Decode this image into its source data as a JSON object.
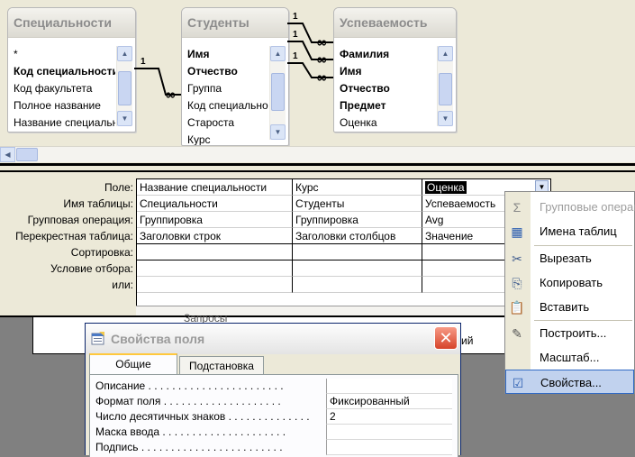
{
  "tables": [
    {
      "title": "Специальности",
      "fields": [
        {
          "name": "*",
          "key": false
        },
        {
          "name": "Код специальности",
          "key": true
        },
        {
          "name": "Код факультета",
          "key": false
        },
        {
          "name": "Полное название",
          "key": false
        },
        {
          "name": "Название специальности",
          "key": false
        }
      ]
    },
    {
      "title": "Студенты",
      "fields": [
        {
          "name": "Имя",
          "key": true
        },
        {
          "name": "Отчество",
          "key": true
        },
        {
          "name": "Группа",
          "key": false
        },
        {
          "name": "Код специальности",
          "key": false
        },
        {
          "name": "Староста",
          "key": false
        },
        {
          "name": "Курс",
          "key": false
        }
      ]
    },
    {
      "title": "Успеваемость",
      "fields": [
        {
          "name": "Фамилия",
          "key": true
        },
        {
          "name": "Имя",
          "key": true
        },
        {
          "name": "Отчество",
          "key": true
        },
        {
          "name": "Предмет",
          "key": true
        },
        {
          "name": "Оценка",
          "key": false
        }
      ]
    }
  ],
  "relationships": {
    "one": "1",
    "many": "∞"
  },
  "grid": {
    "row_labels": [
      "Поле:",
      "Имя таблицы:",
      "Групповая операция:",
      "Перекрестная таблица:",
      "Сортировка:",
      "Условие отбора:",
      "или:"
    ],
    "columns": [
      {
        "field": "Название специальности",
        "table": "Специальности",
        "group": "Группировка",
        "crosstab": "Заголовки строк"
      },
      {
        "field": "Курс",
        "table": "Студенты",
        "group": "Группировка",
        "crosstab": "Заголовки столбцов"
      },
      {
        "field": "Оценка",
        "table": "Успеваемость",
        "group": "Avg",
        "crosstab": "Значение"
      }
    ]
  },
  "background": {
    "partial_text_left": "Запросы",
    "partial_text_right": "ий"
  },
  "dialog": {
    "title": "Свойства поля",
    "close": "✕",
    "tabs": [
      "Общие",
      "Подстановка"
    ],
    "active_tab": "Общие",
    "properties": [
      {
        "label": "Описание . . . . . . . . . . . . . . . . . . . . . . .",
        "value": ""
      },
      {
        "label": "Формат поля . . . . . . . . . . . . . . . . . . . .",
        "value": "Фиксированный"
      },
      {
        "label": "Число десятичных знаков . . . . . . . . . . . . . .",
        "value": "2"
      },
      {
        "label": "Маска ввода . . . . . . . . . . . . . . . . . . . . .",
        "value": ""
      },
      {
        "label": "Подпись . . . . . . . . . . . . . . . . . . . . . . . .",
        "value": ""
      }
    ]
  },
  "context_menu": {
    "items": [
      {
        "label": "Групповые операции",
        "icon": "sigma-icon",
        "glyph": "Σ",
        "disabled": true
      },
      {
        "label": "Имена таблиц",
        "icon": "table-names-icon",
        "glyph": "▦",
        "disabled": false
      },
      {
        "label": "Вырезать",
        "icon": "scissors-icon",
        "glyph": "✂",
        "disabled": false
      },
      {
        "label": "Копировать",
        "icon": "copy-icon",
        "glyph": "⎘",
        "disabled": false
      },
      {
        "label": "Вставить",
        "icon": "paste-icon",
        "glyph": "📋",
        "disabled": false
      },
      {
        "label": "Построить...",
        "icon": "builder-icon",
        "glyph": "✎",
        "disabled": false
      },
      {
        "label": "Масштаб...",
        "icon": "zoom-icon",
        "glyph": "",
        "disabled": false
      },
      {
        "label": "Свойства...",
        "icon": "properties-icon",
        "glyph": "☑",
        "disabled": false,
        "highlighted": true
      }
    ]
  }
}
